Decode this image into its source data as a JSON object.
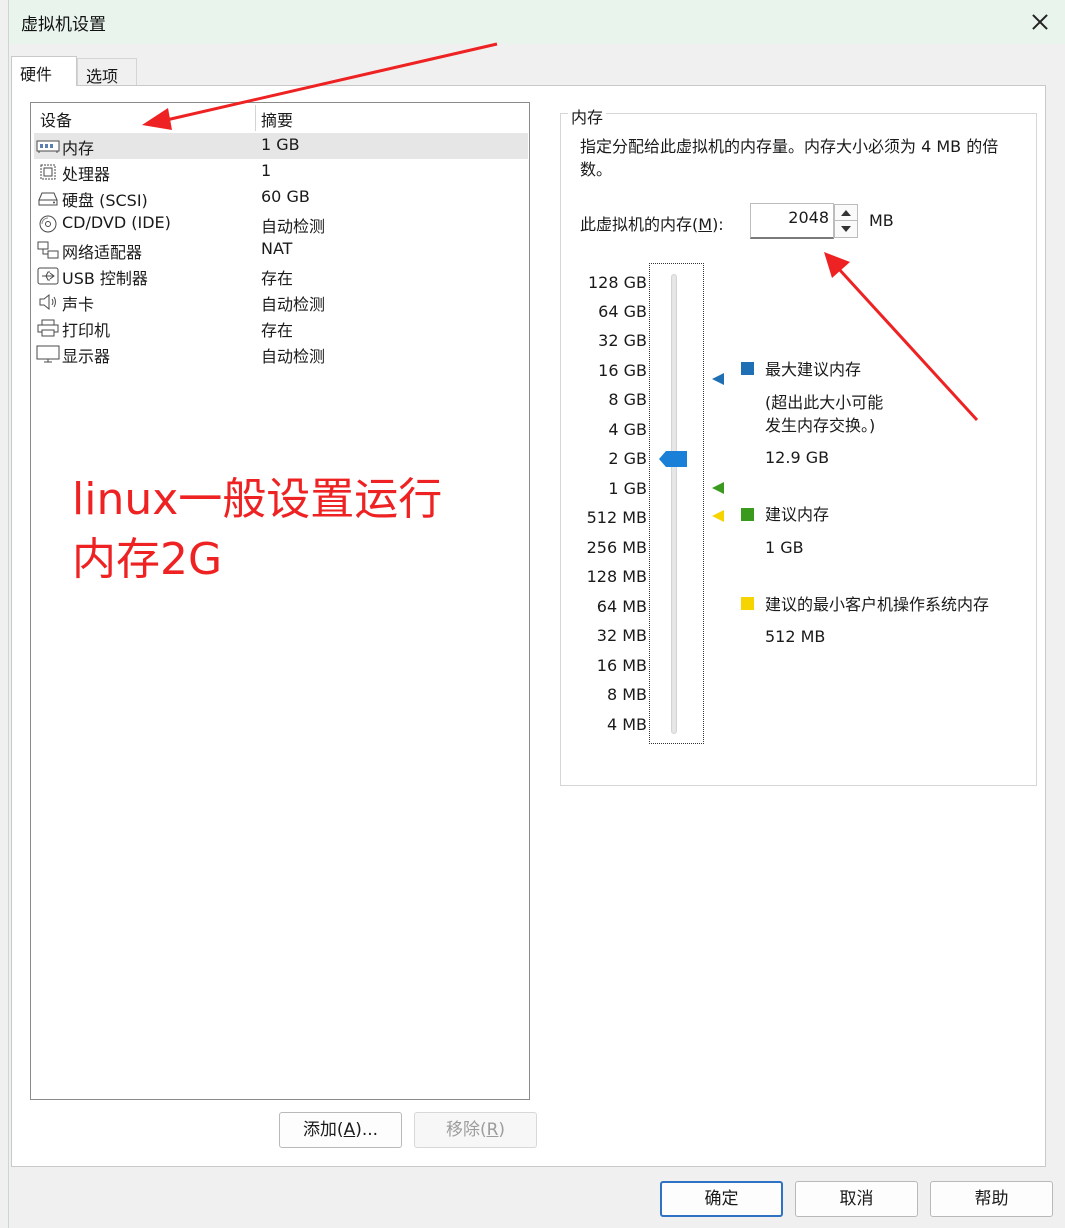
{
  "window": {
    "title": "虚拟机设置"
  },
  "tabs": [
    {
      "label": "硬件"
    },
    {
      "label": "选项"
    }
  ],
  "device_list": {
    "headers": {
      "device": "设备",
      "summary": "摘要"
    },
    "rows": [
      {
        "name": "内存",
        "summary": "1 GB",
        "icon": "memory-icon"
      },
      {
        "name": "处理器",
        "summary": "1",
        "icon": "processor-icon"
      },
      {
        "name": "硬盘 (SCSI)",
        "summary": "60 GB",
        "icon": "hard-disk-icon"
      },
      {
        "name": "CD/DVD (IDE)",
        "summary": "自动检测",
        "icon": "cd-dvd-icon"
      },
      {
        "name": "网络适配器",
        "summary": "NAT",
        "icon": "network-adapter-icon"
      },
      {
        "name": "USB 控制器",
        "summary": "存在",
        "icon": "usb-icon"
      },
      {
        "name": "声卡",
        "summary": "自动检测",
        "icon": "speaker-icon"
      },
      {
        "name": "打印机",
        "summary": "存在",
        "icon": "printer-icon"
      },
      {
        "name": "显示器",
        "summary": "自动检测",
        "icon": "monitor-icon"
      }
    ]
  },
  "annotation": {
    "line1": "linux一般设置运行",
    "line2": "内存2G",
    "color": "#ee2222"
  },
  "buttons": {
    "add": {
      "text": "添加(",
      "key": "A",
      "suffix": ")..."
    },
    "remove": {
      "text": "移除(",
      "key": "R",
      "suffix": ")"
    },
    "ok": "确定",
    "cancel": "取消",
    "help": "帮助"
  },
  "memory": {
    "group_title": "内存",
    "description": "指定分配给此虚拟机的内存量。内存大小必须为 4 MB 的倍数。",
    "field_label_prefix": "此虚拟机的内存(",
    "field_label_key": "M",
    "field_label_suffix": "):",
    "value": "2048",
    "unit": "MB",
    "scale": [
      "128 GB",
      "64 GB",
      "32 GB",
      "16 GB",
      "8 GB",
      "4 GB",
      "2 GB",
      "1 GB",
      "512 MB",
      "256 MB",
      "128 MB",
      "64 MB",
      "32 MB",
      "16 MB",
      "8 MB",
      "4 MB"
    ],
    "slider_value": "2 GB",
    "legend": {
      "max": {
        "label": "最大建议内存",
        "note_line1": "(超出此大小可能",
        "note_line2": "发生内存交换。)",
        "value": "12.9 GB",
        "color": "#1f6fb5"
      },
      "recommended": {
        "label": "建议内存",
        "value": "1 GB",
        "color": "#3a9a1e"
      },
      "min_guest": {
        "label": "建议的最小客户机操作系统内存",
        "value": "512 MB",
        "color": "#f5d400"
      }
    }
  }
}
